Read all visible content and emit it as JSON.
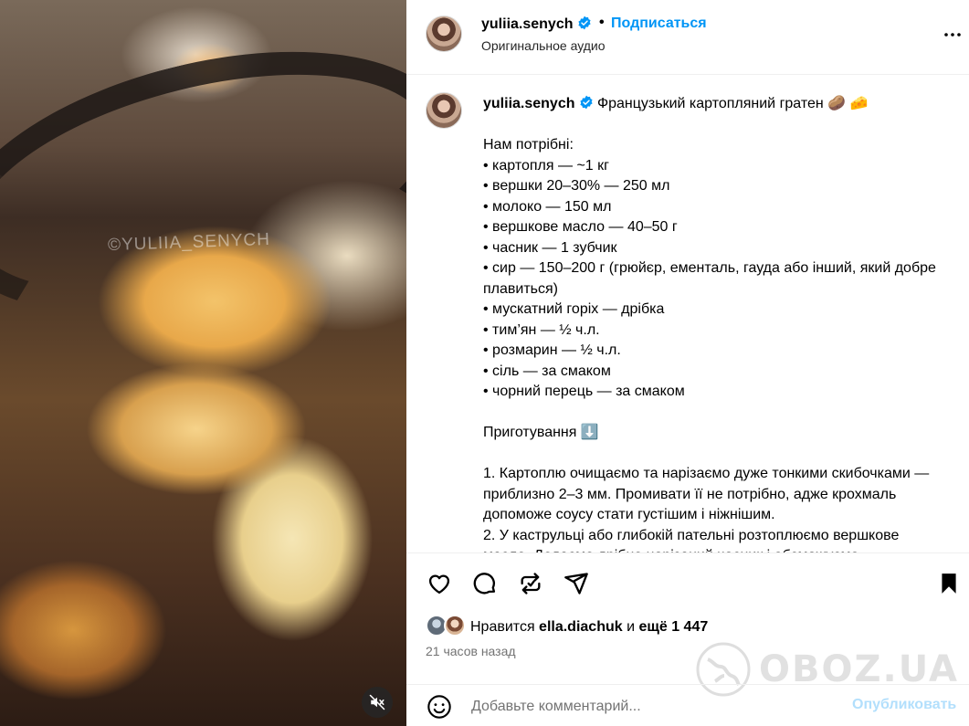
{
  "media": {
    "watermark": "©YULIIA_SENYCH",
    "mute_icon": "speaker-muted-icon"
  },
  "header": {
    "username": "yuliia.senych",
    "separator": "•",
    "follow_label": "Подписаться",
    "subtitle": "Оригинальное аудио",
    "more_icon": "more-horizontal-icon"
  },
  "caption": {
    "username": "yuliia.senych",
    "text": " Французький картопляний гратен 🥔 🧀\n\nНам потрібні:\n• картопля — ~1 кг\n• вершки 20–30% — 250 мл\n• молоко — 150 мл\n• вершкове масло — 40–50 г\n• часник — 1 зубчик\n• сир — 150–200 г (грюйєр, ементаль, гауда або інший, який добре плавиться)\n• мускатний горіх — дрібка\n• тим’ян — ½ ч.л.\n• розмарин — ½ ч.л.\n• сіль — за смаком\n• чорний перець — за смаком\n\nПриготування ⬇️\n\n1. Картоплю очищаємо та нарізаємо дуже тонкими скибочками — приблизно 2–3 мм. Промивати її не потрібно, адже крохмаль допоможе соусу стати густішим і ніжнішим.\n2. У каструльці або глибокій пательні розтоплюємо вершкове масло. Додаємо дрібно нарізаний часник і обсмажуємо"
  },
  "actions": {
    "likes_prefix": "Нравится ",
    "liker": "ella.diachuk",
    "likes_middle": " и ",
    "likes_count": "ещё 1 447",
    "timestamp": "21 часов назад"
  },
  "comment": {
    "placeholder": "Добавьте комментарий...",
    "publish_label": "Опубликовать"
  },
  "watermark_site": {
    "text": "OBOZ.UA"
  },
  "colors": {
    "accent": "#0095f6",
    "publish_disabled": "#b2dffc",
    "muted_text": "#737373",
    "divider": "#efefef"
  }
}
